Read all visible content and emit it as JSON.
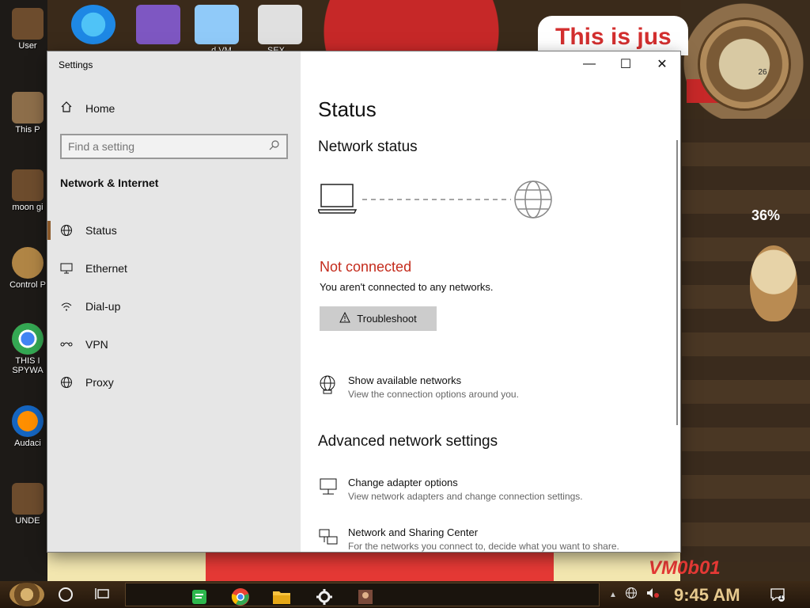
{
  "desktop": {
    "banner_text": "This is jus",
    "percent": "36%",
    "clock_number": "26",
    "corner_text": "VM0b01",
    "icons_left": [
      {
        "label": "User",
        "color": "#6d4c2d"
      },
      {
        "label": "This P",
        "color": "#8d6e4a"
      },
      {
        "label": "moon gi",
        "color": "#6d4c2d"
      },
      {
        "label": "Control P",
        "color": "#b08545"
      },
      {
        "label": "THIS I",
        "color": "#4285f4"
      },
      {
        "label": "SPYWA",
        "color": "#4285f4"
      },
      {
        "label": "Audaci",
        "color": "#ff8f00"
      },
      {
        "label": "UNDE",
        "color": "#6d4c2d"
      }
    ],
    "icons_top": [
      {
        "name": "edge-icon",
        "color": "#1e88e5"
      },
      {
        "name": "visual-studio-icon",
        "color": "#7e57c2"
      },
      {
        "name": "virtualbox-icon",
        "color": "#90caf9"
      },
      {
        "name": "hxd-icon",
        "color": "#e0e0e0"
      }
    ],
    "top_labels": [
      "...d VM",
      "SEX"
    ]
  },
  "window": {
    "title": "Settings",
    "controls": {
      "minimize": "—",
      "maximize": "☐",
      "close": "✕"
    },
    "nav": {
      "home_label": "Home",
      "search_placeholder": "Find a setting",
      "section_title": "Network & Internet",
      "items": [
        {
          "label": "Status",
          "icon": "globe-icon"
        },
        {
          "label": "Ethernet",
          "icon": "ethernet-icon"
        },
        {
          "label": "Dial-up",
          "icon": "dialup-icon"
        },
        {
          "label": "VPN",
          "icon": "vpn-icon"
        },
        {
          "label": "Proxy",
          "icon": "proxy-icon"
        }
      ]
    },
    "content": {
      "title": "Status",
      "network_status_heading": "Network status",
      "status_text": "Not connected",
      "status_description": "You aren't connected to any networks.",
      "troubleshoot_label": "Troubleshoot",
      "show_networks_title": "Show available networks",
      "show_networks_subtitle": "View the connection options around you.",
      "advanced_heading": "Advanced network settings",
      "adapter_title": "Change adapter options",
      "adapter_subtitle": "View network adapters and change connection settings.",
      "sharing_title": "Network and Sharing Center",
      "sharing_subtitle": "For the networks you connect to, decide what you want to share."
    }
  },
  "taskbar": {
    "time": "9:45 AM",
    "apps": [
      "notes-icon",
      "chrome-icon",
      "file-explorer-icon",
      "settings-icon",
      "app-icon"
    ],
    "notification_count": "1"
  }
}
